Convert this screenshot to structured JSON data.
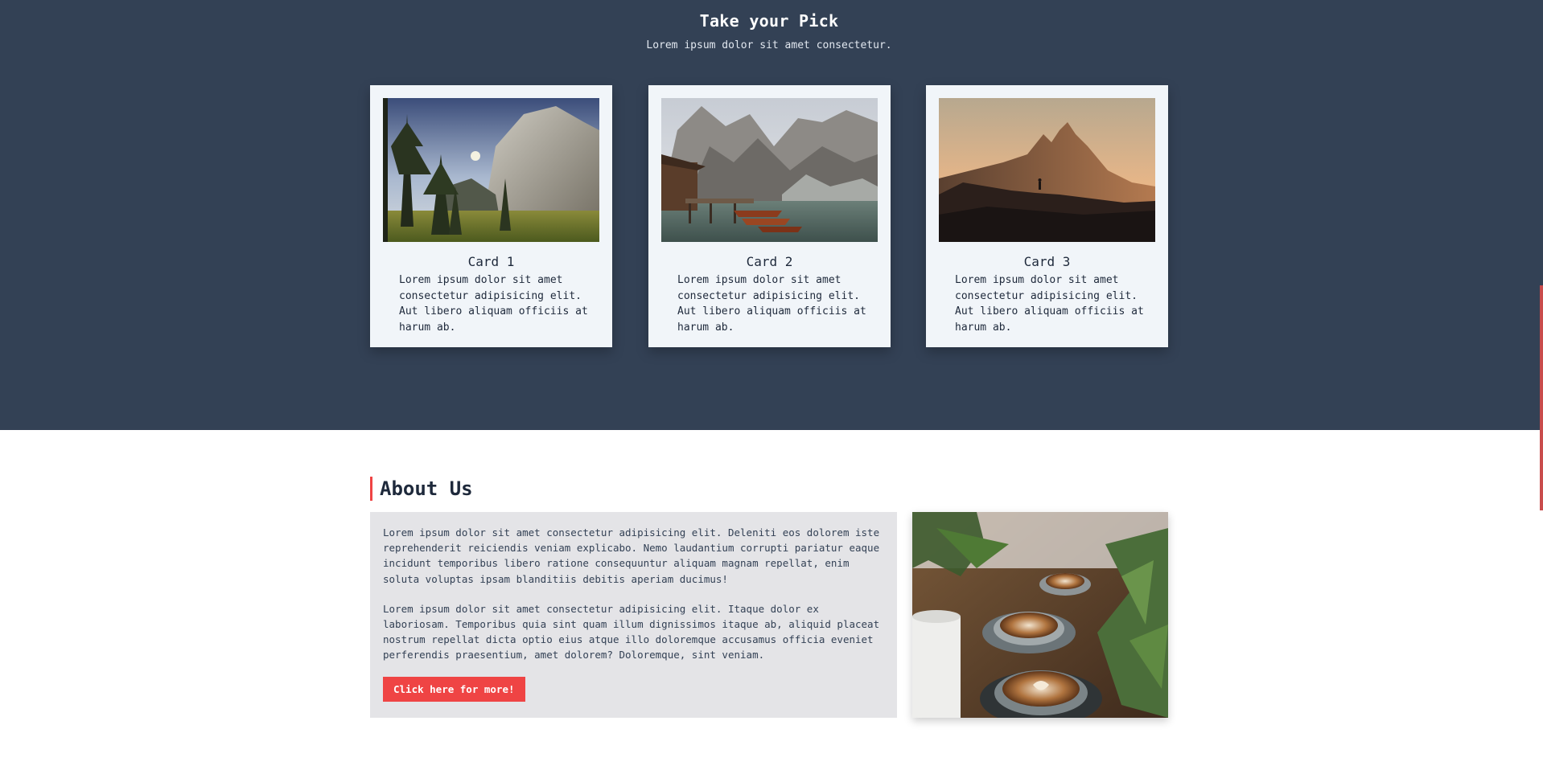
{
  "pick": {
    "title": "Take your Pick",
    "subtitle": "Lorem ipsum dolor sit amet consectetur."
  },
  "cards": [
    {
      "title": "Card 1",
      "text": "Lorem ipsum dolor sit amet consectetur adipisicing elit. Aut libero aliquam officiis at harum ab.",
      "image": "forest-cliff-photo"
    },
    {
      "title": "Card 2",
      "text": "Lorem ipsum dolor sit amet consectetur adipisicing elit. Aut libero aliquam officiis at harum ab.",
      "image": "mountain-lake-boats-photo"
    },
    {
      "title": "Card 3",
      "text": "Lorem ipsum dolor sit amet consectetur adipisicing elit. Aut libero aliquam officiis at harum ab.",
      "image": "mountain-silhouette-photo"
    }
  ],
  "about": {
    "heading": "About Us",
    "paragraphs": [
      "Lorem ipsum dolor sit amet consectetur adipisicing elit. Deleniti eos dolorem iste reprehenderit reiciendis veniam explicabo. Nemo laudantium corrupti pariatur eaque incidunt temporibus libero ratione consequuntur aliquam magnam repellat, enim soluta voluptas ipsam blanditiis debitis aperiam ducimus!",
      "Lorem ipsum dolor sit amet consectetur adipisicing elit. Itaque dolor ex laboriosam. Temporibus quia sint quam illum dignissimos itaque ab, aliquid placeat nostrum repellat dicta optio eius atque illo doloremque accusamus officia eveniet perferendis praesentium, amet dolorem? Doloremque, sint veniam."
    ],
    "button_label": "Click here for more!",
    "image": "coffee-cups-photo"
  },
  "colors": {
    "dark_section": "#334155",
    "card_bg": "#f1f5f9",
    "accent": "#ef4444",
    "about_box": "#e4e4e7"
  }
}
